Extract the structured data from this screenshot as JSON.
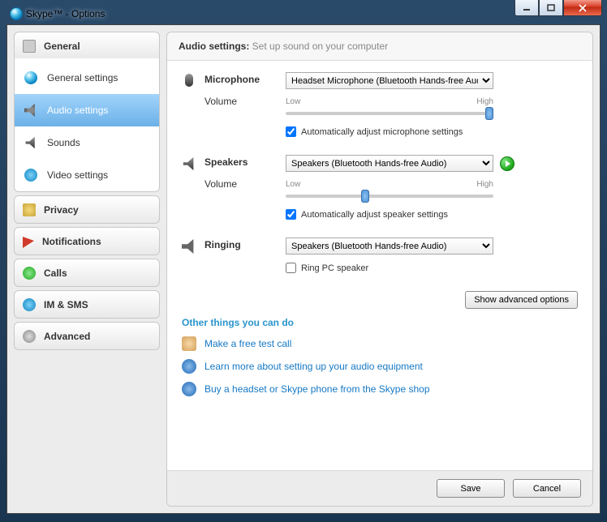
{
  "window": {
    "title": "Skype™ - Options"
  },
  "sidebar": {
    "general": {
      "label": "General"
    },
    "general_subs": [
      {
        "label": "General settings"
      },
      {
        "label": "Audio settings"
      },
      {
        "label": "Sounds"
      },
      {
        "label": "Video settings"
      }
    ],
    "privacy": {
      "label": "Privacy"
    },
    "notifications": {
      "label": "Notifications"
    },
    "calls": {
      "label": "Calls"
    },
    "im_sms": {
      "label": "IM & SMS"
    },
    "advanced": {
      "label": "Advanced"
    }
  },
  "header": {
    "title": "Audio settings:",
    "subtitle": "Set up sound on your computer"
  },
  "mic": {
    "label": "Microphone",
    "device": "Headset Microphone (Bluetooth Hands-free Audio)",
    "volume_label": "Volume",
    "low": "Low",
    "high": "High",
    "volume_value": 100,
    "auto_checked": true,
    "auto_label": "Automatically adjust microphone settings"
  },
  "speakers": {
    "label": "Speakers",
    "device": "Speakers (Bluetooth Hands-free Audio)",
    "volume_label": "Volume",
    "low": "Low",
    "high": "High",
    "volume_value": 38,
    "auto_checked": true,
    "auto_label": "Automatically adjust speaker settings"
  },
  "ringing": {
    "label": "Ringing",
    "device": "Speakers (Bluetooth Hands-free Audio)",
    "ring_pc_checked": false,
    "ring_pc_label": "Ring PC speaker"
  },
  "advanced_button": "Show advanced options",
  "other": {
    "title": "Other things you can do",
    "links": [
      "Make a free test call",
      "Learn more about setting up your audio equipment",
      "Buy a headset or Skype phone from the Skype shop"
    ]
  },
  "footer": {
    "save": "Save",
    "cancel": "Cancel"
  }
}
